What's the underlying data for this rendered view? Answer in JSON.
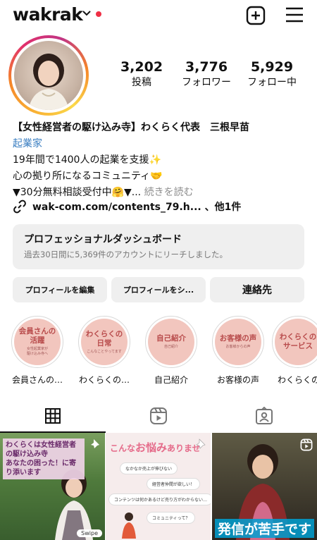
{
  "header": {
    "username": "wakrak",
    "icons": [
      "chevron-down-icon",
      "notification-dot",
      "plus-square-icon",
      "hamburger-menu-icon"
    ]
  },
  "stats": [
    {
      "value": "3,202",
      "label": "投稿"
    },
    {
      "value": "3,776",
      "label": "フォロワー"
    },
    {
      "value": "5,929",
      "label": "フォロー中"
    }
  ],
  "bio": {
    "name": "【女性経営者の駆け込み寺】わくらく代表　三根早苗",
    "category": "起業家",
    "line1": "19年間で1400人の起業を支援✨",
    "line2": "心の拠り所になるコミュニティ🤝",
    "line3": "▼30分無料相談受付中🤗▼...",
    "more": "続きを読む",
    "link": "wak-com.com/contents_79.h... 、他1件"
  },
  "dashboard": {
    "title": "プロフェッショナルダッシュボード",
    "subtitle": "過去30日間に5,369件のアカウントにリーチしました。"
  },
  "buttons": {
    "edit": "プロフィールを編集",
    "share": "プロフィールをシ...",
    "contact": "連絡先"
  },
  "highlights": [
    {
      "cover": "会員さんの\n活躍",
      "cover_sub": "女性起業家が\n駆け込み寺へ",
      "caption": "会員さんの…"
    },
    {
      "cover": "わくらくの\n日常",
      "cover_sub": "こんなことやってます",
      "caption": "わくらくの…"
    },
    {
      "cover": "自己紹介",
      "cover_sub": "自己紹介",
      "caption": "自己紹介"
    },
    {
      "cover": "お客様の声",
      "cover_sub": "お客様からの声",
      "caption": "お客様の声"
    },
    {
      "cover": "わくらくの\nサービス",
      "cover_sub": "",
      "caption": "わくらくの…"
    }
  ],
  "tabs": [
    "grid-icon",
    "reels-icon",
    "tagged-icon"
  ],
  "posts": {
    "post1": {
      "caption": "わくらくは女性経営者の駆け込み寺\nあなたの困った！に寄り添います",
      "swipe": "Swipe"
    },
    "post2": {
      "title_pre": "こんな",
      "title_em": "お悩み",
      "title_post": "ありませ",
      "bubbles": [
        "なかなか売上が伸びない",
        "経営者仲間が欲しい！",
        "コンテンツは何かあるけど売り方がわからない…",
        "コミュニティって？"
      ]
    },
    "post3": {
      "caption": "発信が苦手です"
    }
  },
  "colors": {
    "accent_link": "#3a7ec1",
    "notification": "#ef2f45",
    "highlight_fill": "#f2c6be"
  }
}
